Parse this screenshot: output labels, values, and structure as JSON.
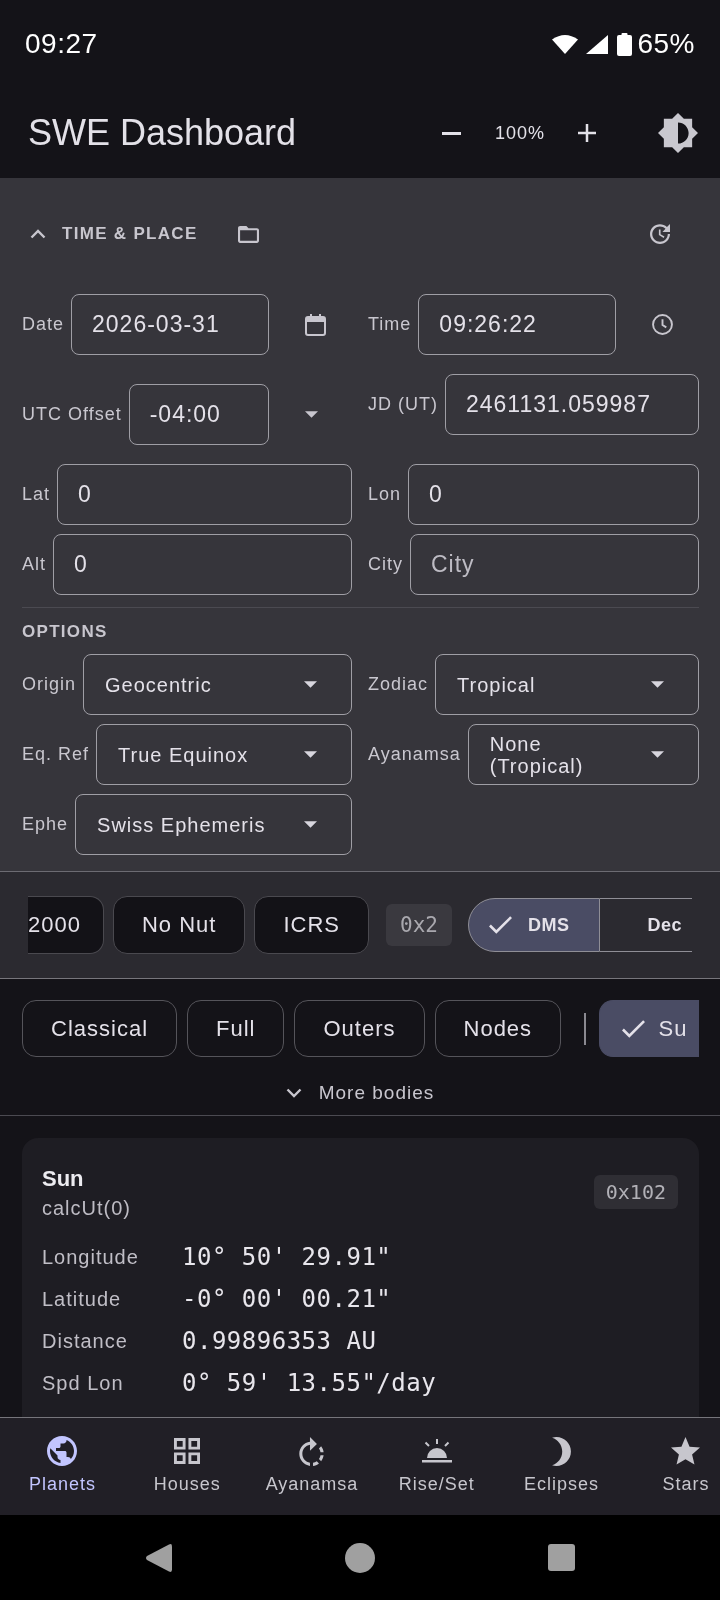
{
  "status_bar": {
    "time": "09:27",
    "battery": "65%"
  },
  "app_bar": {
    "title": "SWE Dashboard",
    "zoom": "100%"
  },
  "time_place": {
    "title": "TIME & PLACE",
    "expanded": true,
    "rows": [
      [
        {
          "label": "Date",
          "kind": "date",
          "value": "2026-03-31"
        },
        {
          "label": "Time",
          "kind": "time",
          "value": "09:26:22"
        }
      ],
      [
        {
          "label": "UTC Offset",
          "kind": "menu",
          "value": "-04:00"
        },
        {
          "label": "JD (UT)",
          "kind": "text",
          "value": "2461131.059987"
        }
      ],
      [
        {
          "label": "Lat",
          "kind": "text",
          "value": "0"
        },
        {
          "label": "Lon",
          "kind": "text",
          "value": "0"
        }
      ],
      [
        {
          "label": "Alt",
          "kind": "text",
          "value": "0"
        },
        {
          "label": "City",
          "kind": "text",
          "placeholder": "City"
        }
      ]
    ],
    "options": {
      "title": "OPTIONS",
      "rows": [
        [
          {
            "label": "Origin",
            "kind": "select",
            "value": "Geocentric"
          },
          {
            "label": "Zodiac",
            "kind": "select",
            "value": "Tropical"
          }
        ],
        [
          {
            "label": "Eq. Ref",
            "kind": "select",
            "value": "True Equinox"
          },
          {
            "label": "Ayanamsa",
            "kind": "select",
            "value": "None (Tropical)"
          }
        ],
        [
          {
            "label": "Ephe",
            "kind": "select",
            "value": "Swiss Ephemeris"
          }
        ]
      ]
    }
  },
  "flags": {
    "chips": [
      {
        "label": "2000",
        "selected": false
      },
      {
        "label": "No Nut",
        "selected": false
      },
      {
        "label": "ICRS",
        "selected": false
      }
    ],
    "value": "0x2",
    "format": [
      {
        "label": "DMS",
        "selected": true
      },
      {
        "label": "Dec",
        "selected": false
      }
    ]
  },
  "bodies": {
    "presets": [
      "Classical",
      "Full",
      "Outers",
      "Nodes"
    ],
    "chips": [
      {
        "label": "Su",
        "selected": true
      }
    ],
    "more": {
      "label": "More bodies",
      "expanded": false
    }
  },
  "result": {
    "name": "Sun",
    "call": "calcUt(0)",
    "flags": "0x102",
    "rows": [
      {
        "label": "Longitude",
        "value": "10° 50' 29.91\""
      },
      {
        "label": "Latitude",
        "value": "-0° 00' 00.21\""
      },
      {
        "label": "Distance",
        "value": "0.99896353 AU"
      },
      {
        "label": "Spd Lon",
        "value": "0° 59' 13.55\"/day"
      }
    ]
  },
  "bottom_nav": [
    {
      "label": "Planets",
      "selected": true
    },
    {
      "label": "Houses",
      "selected": false
    },
    {
      "label": "Ayanamsa",
      "selected": false
    },
    {
      "label": "Rise/Set",
      "selected": false
    },
    {
      "label": "Eclipses",
      "selected": false
    },
    {
      "label": "Stars",
      "selected": false
    }
  ]
}
